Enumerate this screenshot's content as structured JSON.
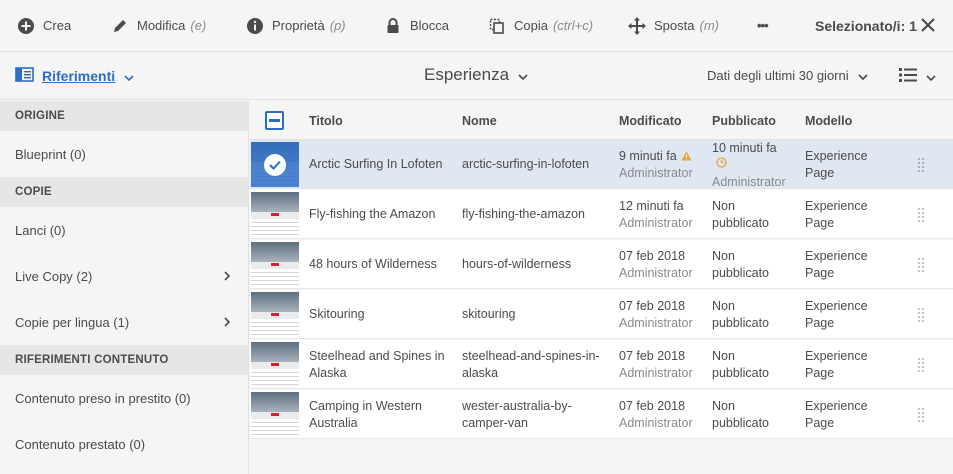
{
  "actionbar": {
    "crea": "Crea",
    "modifica": "Modifica",
    "modifica_kbd": "(e)",
    "proprieta": "Proprietà",
    "proprieta_kbd": "(p)",
    "blocca": "Blocca",
    "copia": "Copia",
    "copia_kbd": "(ctrl+c)",
    "sposta": "Sposta",
    "sposta_kbd": "(m)",
    "more": "•••",
    "selected_count": "Selezionato/i: 1"
  },
  "header": {
    "rail_label": "Riferimenti",
    "view_title": "Esperienza",
    "date_filter": "Dati degli ultimi 30 giorni"
  },
  "rail": {
    "sections": [
      {
        "title": "ORIGINE",
        "items": [
          {
            "label": "Blueprint (0)",
            "has_arrow": false
          }
        ]
      },
      {
        "title": "COPIE",
        "items": [
          {
            "label": "Lanci (0)",
            "has_arrow": false
          },
          {
            "label": "Live Copy (2)",
            "has_arrow": true
          },
          {
            "label": "Copie per lingua (1)",
            "has_arrow": true
          }
        ]
      },
      {
        "title": "RIFERIMENTI CONTENUTO",
        "items": [
          {
            "label": "Contenuto preso in prestito (0)",
            "has_arrow": false
          },
          {
            "label": "Contenuto prestato (0)",
            "has_arrow": false
          }
        ]
      }
    ]
  },
  "table": {
    "columns": {
      "title": "Titolo",
      "name": "Nome",
      "modified": "Modificato",
      "published": "Pubblicato",
      "template": "Modello"
    },
    "rows": [
      {
        "title": "Arctic Surfing In Lofoten",
        "name": "arctic-surfing-in-lofoten",
        "modified": "9 minuti fa",
        "modified_by": "Administrator",
        "modified_warning": true,
        "published": "10 minuti fa",
        "published_by": "Administrator",
        "published_pending": true,
        "template_1": "Experience",
        "template_2": "Page",
        "selected": true
      },
      {
        "title": "Fly-fishing the Amazon",
        "name": "fly-fishing-the-amazon",
        "modified": "12 minuti fa",
        "modified_by": "Administrator",
        "published": "Non",
        "published_by": "pubblicato",
        "template_1": "Experience",
        "template_2": "Page"
      },
      {
        "title": "48 hours of Wilderness",
        "name": "hours-of-wilderness",
        "modified": "07 feb 2018",
        "modified_by": "Administrator",
        "published": "Non",
        "published_by": "pubblicato",
        "template_1": "Experience",
        "template_2": "Page"
      },
      {
        "title": "Skitouring",
        "name": "skitouring",
        "modified": "07 feb 2018",
        "modified_by": "Administrator",
        "published": "Non",
        "published_by": "pubblicato",
        "template_1": "Experience",
        "template_2": "Page"
      },
      {
        "title_1": "Steelhead and Spines in",
        "title_2": "Alaska",
        "name_1": "steelhead-and-spines-in-",
        "name_2": "alaska",
        "modified": "07 feb 2018",
        "modified_by": "Administrator",
        "published": "Non",
        "published_by": "pubblicato",
        "template_1": "Experience",
        "template_2": "Page"
      },
      {
        "title_1": "Camping in Western",
        "title_2": "Australia",
        "name_1": "wester-australia-by-",
        "name_2": "camper-van",
        "modified": "07 feb 2018",
        "modified_by": "Administrator",
        "published": "Non",
        "published_by": "pubblicato",
        "template_1": "Experience",
        "template_2": "Page"
      }
    ]
  },
  "icons": {
    "crea": "add-circle-icon",
    "modifica": "pencil-icon",
    "proprieta": "info-icon",
    "blocca": "lock-icon",
    "copia": "copy-icon",
    "sposta": "move-icon",
    "close": "close-icon",
    "rail": "rail-icon",
    "view": "list-view-icon"
  },
  "colors": {
    "accent": "#2d6dc6",
    "warning": "#e8a33d",
    "selected_row": "#dfe7f3"
  }
}
